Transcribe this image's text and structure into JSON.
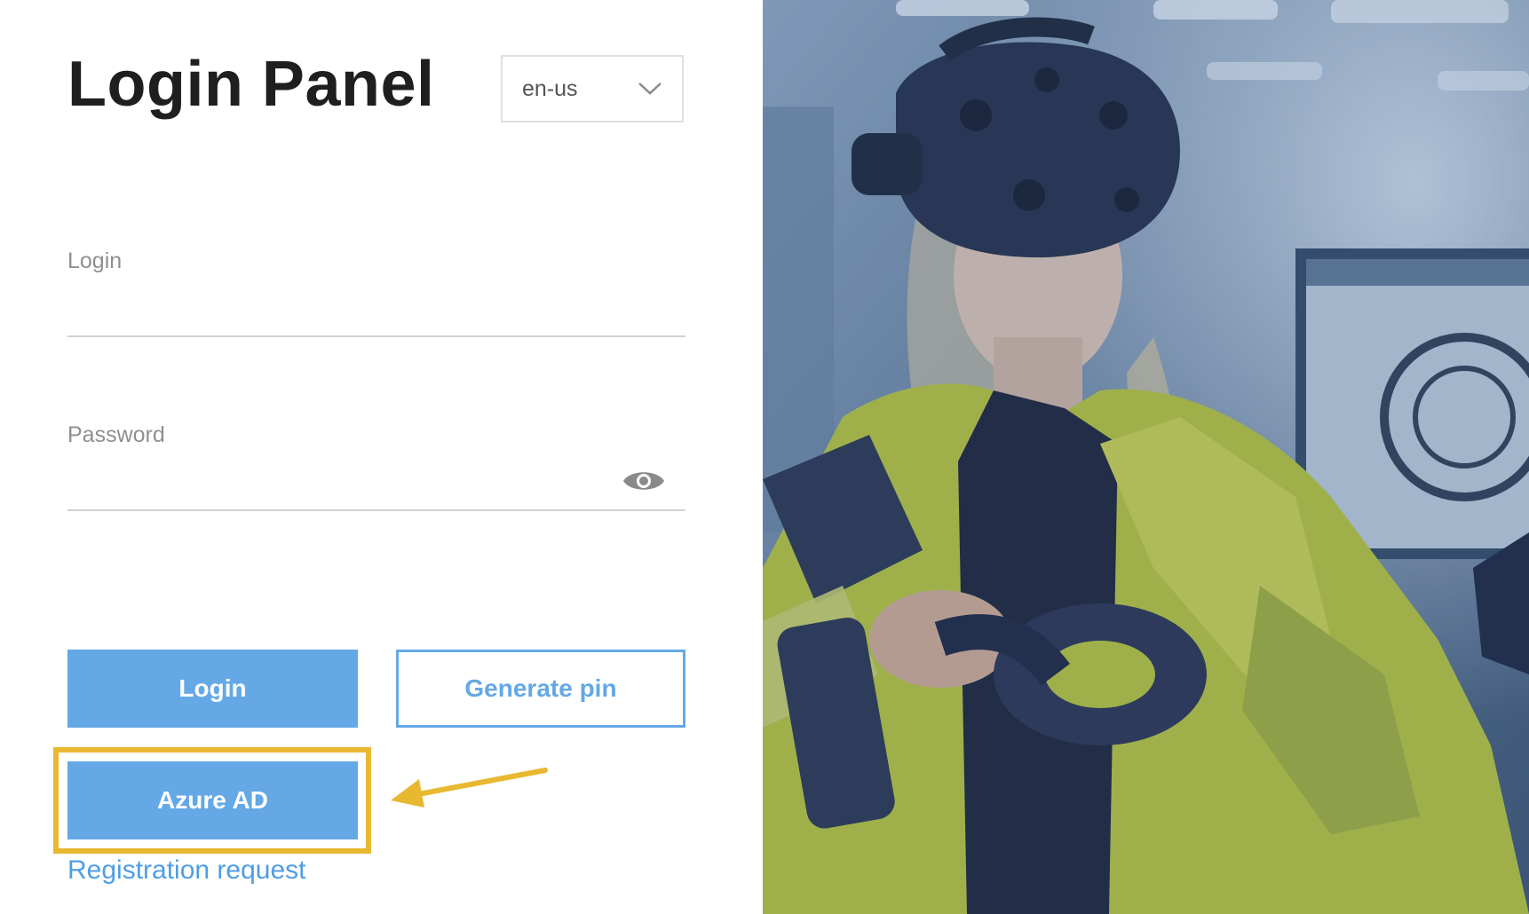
{
  "panel": {
    "title": "Login Panel",
    "language": {
      "selected": "en-us",
      "icon": "chevron-down-icon"
    },
    "login_field": {
      "label": "Login",
      "value": ""
    },
    "password_field": {
      "label": "Password",
      "value": "",
      "toggle_icon": "eye-icon"
    },
    "buttons": {
      "login": "Login",
      "generate_pin": "Generate pin",
      "azure_ad": "Azure AD"
    },
    "registration_link": "Registration request"
  },
  "annotation": {
    "highlight_color": "#e8b830",
    "arrow_icon": "arrow-left-icon"
  },
  "colors": {
    "accent": "#64a8e6",
    "title": "#1f1f1f",
    "label": "#8f8f8f"
  },
  "hero": {
    "subject": "woman-vr-headset-photo"
  }
}
